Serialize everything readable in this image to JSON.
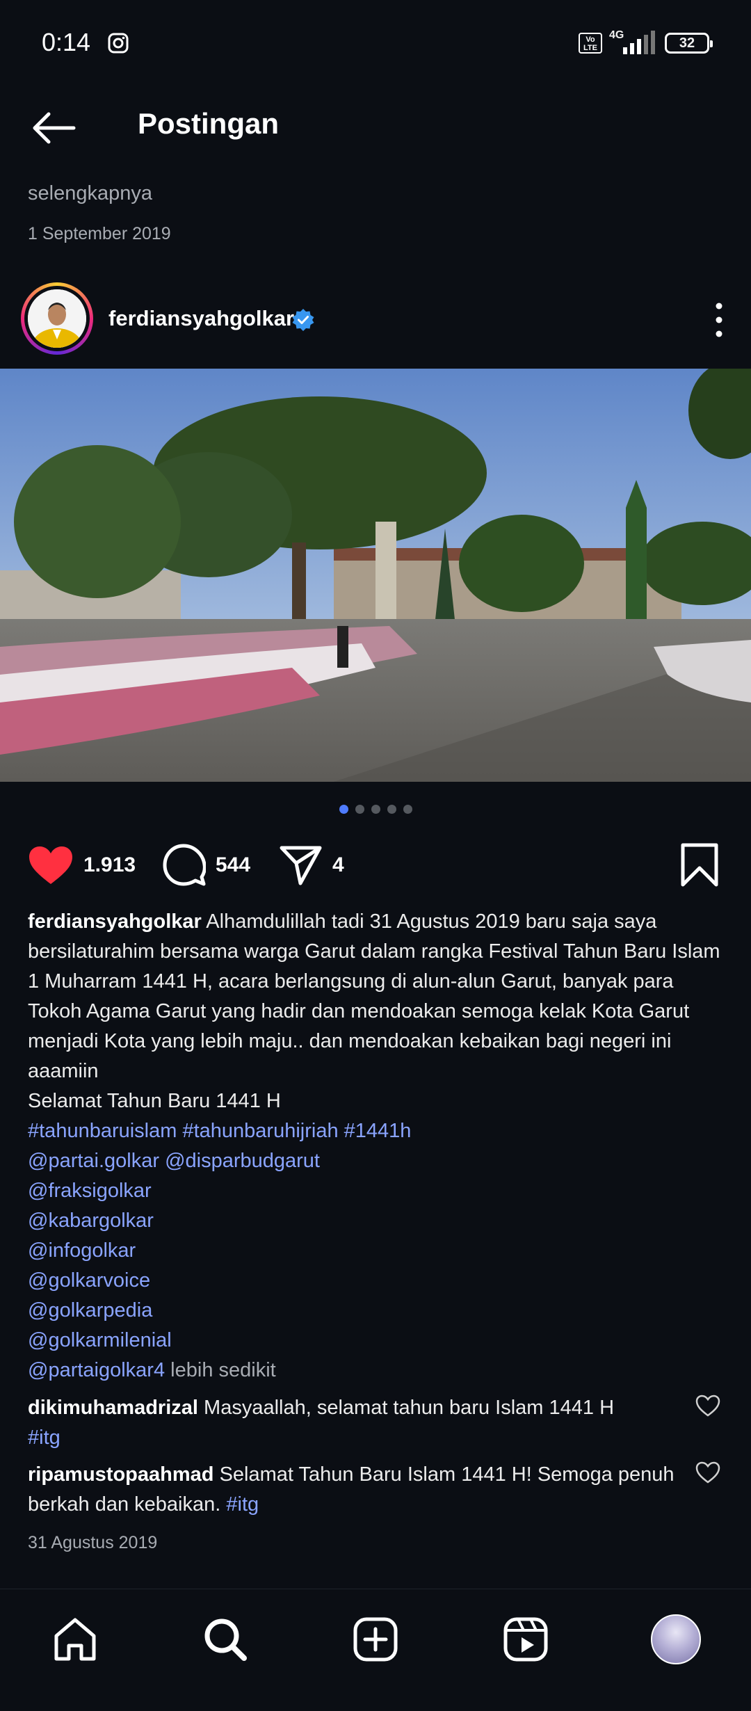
{
  "status_bar": {
    "time": "0:14",
    "network": "4G",
    "volte": "Vo LTE",
    "battery": "32"
  },
  "header": {
    "title": "Postingan"
  },
  "previous_post": {
    "see_more": "selengkapnya",
    "date": "1 September 2019"
  },
  "post": {
    "username": "ferdiansyahgolkar",
    "verified": true,
    "carousel": {
      "count": 5,
      "active_index": 0
    },
    "likes": "1.913",
    "comments": "544",
    "shares": "4",
    "caption": {
      "username": "ferdiansyahgolkar",
      "text": "Alhamdulillah tadi 31 Agustus 2019 baru saja saya bersilaturahim bersama warga Garut dalam rangka Festival Tahun Baru Islam 1 Muharram 1441 H, acara berlangsung di alun-alun Garut, banyak para Tokoh Agama Garut yang hadir dan mendoakan semoga kelak Kota Garut menjadi Kota yang lebih maju.. dan mendoakan kebaikan bagi negeri ini aaamiin",
      "line2": "Selamat Tahun Baru 1441 H",
      "hashtags": "#tahunbaruislam #tahunbaruhijriah #1441h",
      "mentions_line": "@partai.golkar @disparbudgarut",
      "mentions": [
        "@fraksigolkar",
        "@kabargolkar",
        "@infogolkar",
        "@golkarvoice",
        "@golkarpedia",
        "@golkarmilenial"
      ],
      "last_mention": "@partaigolkar4",
      "less": "lebih sedikit"
    },
    "comments_list": [
      {
        "username": "dikimuhamadrizal",
        "text": "Masyaallah, selamat tahun baru Islam 1441 H",
        "tag": "#itg"
      },
      {
        "username": "ripamustopaahmad",
        "text": "Selamat Tahun Baru Islam 1441 H! Semoga penuh berkah dan kebaikan.",
        "tag": "#itg"
      }
    ],
    "date": "31 Agustus 2019"
  },
  "nav": {
    "items": [
      "home-icon",
      "search-icon",
      "create-icon",
      "reels-icon",
      "profile-avatar"
    ]
  },
  "colors": {
    "background": "#0b0e14",
    "like_red": "#ff3040",
    "link_blue": "#8aa4ff",
    "verified_blue": "#3897f0"
  }
}
